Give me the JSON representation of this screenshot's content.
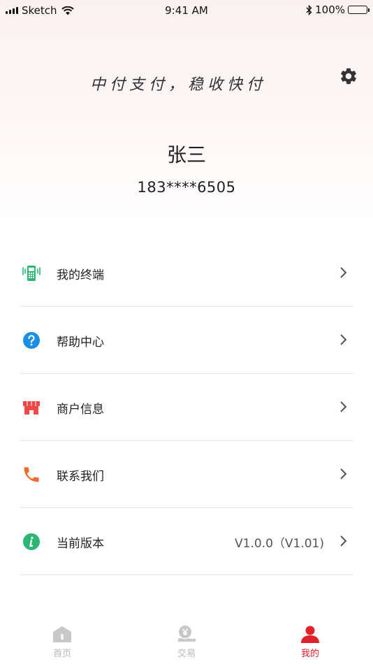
{
  "status_bar": {
    "carrier": "Sketch",
    "time": "9:41 AM",
    "battery": "100%"
  },
  "header": {
    "slogan": "中付支付，稳收快付",
    "user_name": "张三",
    "phone": "183****6505"
  },
  "menu": [
    {
      "label": "我的终端",
      "value": "",
      "icon": "terminal-icon",
      "color": "#2bb673"
    },
    {
      "label": "帮助中心",
      "value": "",
      "icon": "help-icon",
      "color": "#1a8fe8"
    },
    {
      "label": "商户信息",
      "value": "",
      "icon": "store-icon",
      "color": "#f04848"
    },
    {
      "label": "联系我们",
      "value": "",
      "icon": "phone-icon",
      "color": "#f46a2a"
    },
    {
      "label": "当前版本",
      "value": "V1.0.0（V1.01)",
      "icon": "info-icon",
      "color": "#2bb673"
    }
  ],
  "tabs": [
    {
      "label": "首页",
      "icon": "home-icon",
      "active": false
    },
    {
      "label": "交易",
      "icon": "transaction-icon",
      "active": false
    },
    {
      "label": "我的",
      "icon": "profile-icon",
      "active": true
    }
  ],
  "colors": {
    "accent": "#e0232b",
    "inactive": "#b9b9b9"
  }
}
